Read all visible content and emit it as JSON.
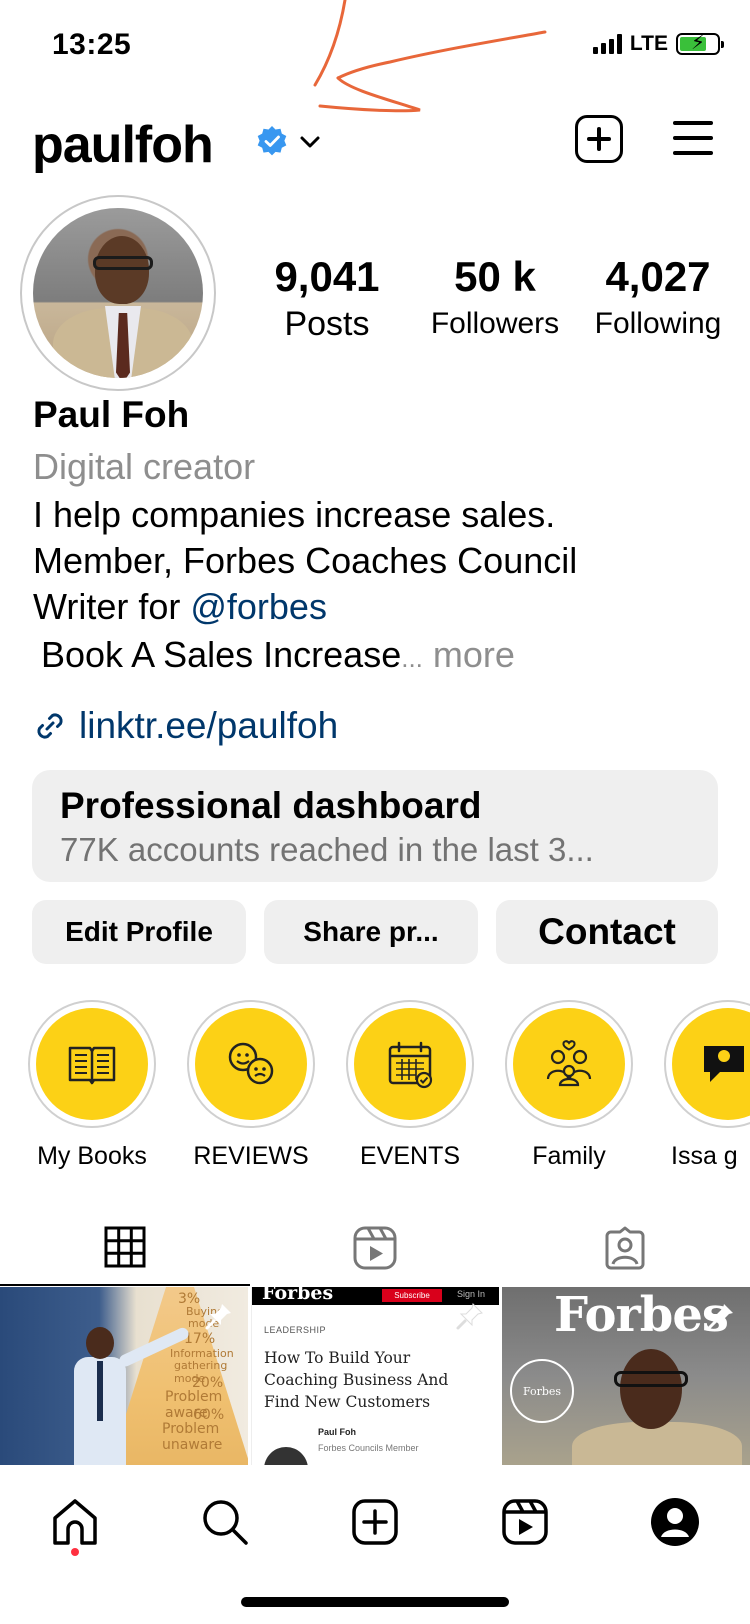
{
  "status_bar": {
    "time": "13:25",
    "network": "LTE",
    "battery_charging": true
  },
  "header": {
    "username": "paulfoh",
    "verified": true
  },
  "profile": {
    "stats": [
      {
        "value": "9,041",
        "label": "Posts"
      },
      {
        "value": "50 k",
        "label": "Followers"
      },
      {
        "value": "4,027",
        "label": "Following"
      }
    ],
    "name": "Paul Foh",
    "category": "Digital creator",
    "bio_line1": "I help companies increase sales.",
    "bio_line2": "Member, Forbes Coaches Council",
    "bio_line3_prefix": "Writer for ",
    "bio_line3_mention": "@forbes",
    "bio_line4": "Book A Sales Increase",
    "ellipsis": "...",
    "more": " more",
    "link": "linktr.ee/paulfoh"
  },
  "dashboard": {
    "title": "Professional dashboard",
    "subtitle": "77K accounts reached in the last 3..."
  },
  "actions": {
    "edit": "Edit Profile",
    "share": "Share pr...",
    "contact": "Contact"
  },
  "highlights": [
    {
      "label": "My Books",
      "icon": "book-icon"
    },
    {
      "label": "REVIEWS",
      "icon": "chat-faces-icon"
    },
    {
      "label": "EVENTS",
      "icon": "calendar-icon"
    },
    {
      "label": "Family",
      "icon": "family-icon"
    },
    {
      "label": "Issa g",
      "icon": "speech-bubble-icon"
    }
  ],
  "tabs": [
    "grid-icon",
    "reels-icon",
    "tagged-icon"
  ],
  "posts": {
    "p1": {
      "lines": [
        "3%",
        "Buying",
        "mode",
        "17%",
        "Information",
        "gathering mode",
        "20%",
        "Problem aware",
        "60%",
        "Problem unaware"
      ]
    },
    "p2": {
      "brand": "Forbes",
      "subscribe": "Subscribe",
      "signin": "Sign In",
      "kicker": "LEADERSHIP",
      "headline": "How To Build Your Coaching Business And Find New Customers",
      "author": "Paul Foh",
      "role": "Forbes Councils Member"
    },
    "p3": {
      "brand": "Forbes",
      "seal": "Forbes"
    }
  },
  "bottom_nav": [
    "home-icon",
    "search-icon",
    "create-icon",
    "reels-icon",
    "profile-icon"
  ],
  "colors": {
    "accent_link": "#00376b",
    "highlight_yellow": "#fcd116",
    "verified_blue": "#3897f0",
    "notification_dot": "#ff3040",
    "annotation_orange": "#e8673a"
  }
}
